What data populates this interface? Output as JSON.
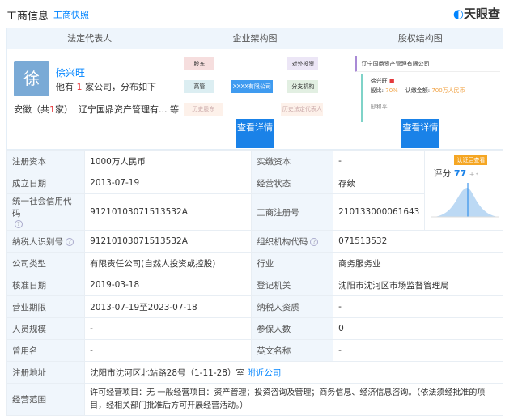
{
  "header": {
    "title": "工商信息",
    "tab": "工商快照",
    "logo": "天眼查"
  },
  "cards": {
    "legal": {
      "title": "法定代表人",
      "avatar": "徐",
      "name": "徐兴旺",
      "count_prefix": "他有",
      "count": "1",
      "count_suffix": "家公司，分布如下",
      "region_prefix": "安徽（共",
      "region_count": "1",
      "region_suffix": "家）",
      "region_company": "辽宁国鼎资产管理有... 等"
    },
    "structure": {
      "title": "企业架构图",
      "nodes": [
        "股东",
        "高管",
        "历史股东",
        "XXXX有限公司",
        "对外投资",
        "分支机构",
        "历史法定代表人"
      ],
      "button": "查看详情"
    },
    "equity": {
      "title": "股权结构图",
      "company": "辽宁国鼎资产管理有限公司",
      "holder1": "徐兴旺",
      "ratio_label": "股比:",
      "ratio1": "70%",
      "sub_label": "认缴金额:",
      "sub1": "700万人民币",
      "holder2": "邸和平",
      "button": "查看详情"
    }
  },
  "table": {
    "rows": [
      {
        "l1": "注册资本",
        "v1": "1000万人民币",
        "l2": "实缴资本",
        "v2": "-"
      },
      {
        "l1": "成立日期",
        "v1": "2013-07-19",
        "l2": "经营状态",
        "v2": "存续"
      },
      {
        "l1": "统一社会信用代码",
        "v1": "91210103071513532A",
        "l2": "工商注册号",
        "v2": "210133000061643"
      },
      {
        "l1": "纳税人识别号",
        "v1": "91210103071513532A",
        "l2": "组织机构代码",
        "v2": "071513532"
      },
      {
        "l1": "公司类型",
        "v1": "有限责任公司(自然人投资或控股)",
        "l2": "行业",
        "v2": "商务服务业"
      },
      {
        "l1": "核准日期",
        "v1": "2019-03-18",
        "l2": "登记机关",
        "v2": "沈阳市沈河区市场监督管理局"
      },
      {
        "l1": "营业期限",
        "v1": "2013-07-19至2023-07-18",
        "l2": "纳税人资质",
        "v2": "-"
      },
      {
        "l1": "人员规模",
        "v1": "-",
        "l2": "参保人数",
        "v2": "0"
      },
      {
        "l1": "曾用名",
        "v1": "-",
        "l2": "英文名称",
        "v2": "-"
      }
    ],
    "address": {
      "label": "注册地址",
      "value": "沈阳市沈河区北站路28号（1-11-28）室",
      "link": "附近公司"
    },
    "scope": {
      "label": "经营范围",
      "value": "许可经营项目：无 一般经营项目：资产管理；投资咨询及管理；商务信息、经济信息咨询。（依法须经批准的项目，经相关部门批准后方可开展经营活动。）"
    },
    "score": {
      "badge": "认证后查看",
      "label": "评分",
      "value": "77",
      "extra": "+3"
    }
  }
}
